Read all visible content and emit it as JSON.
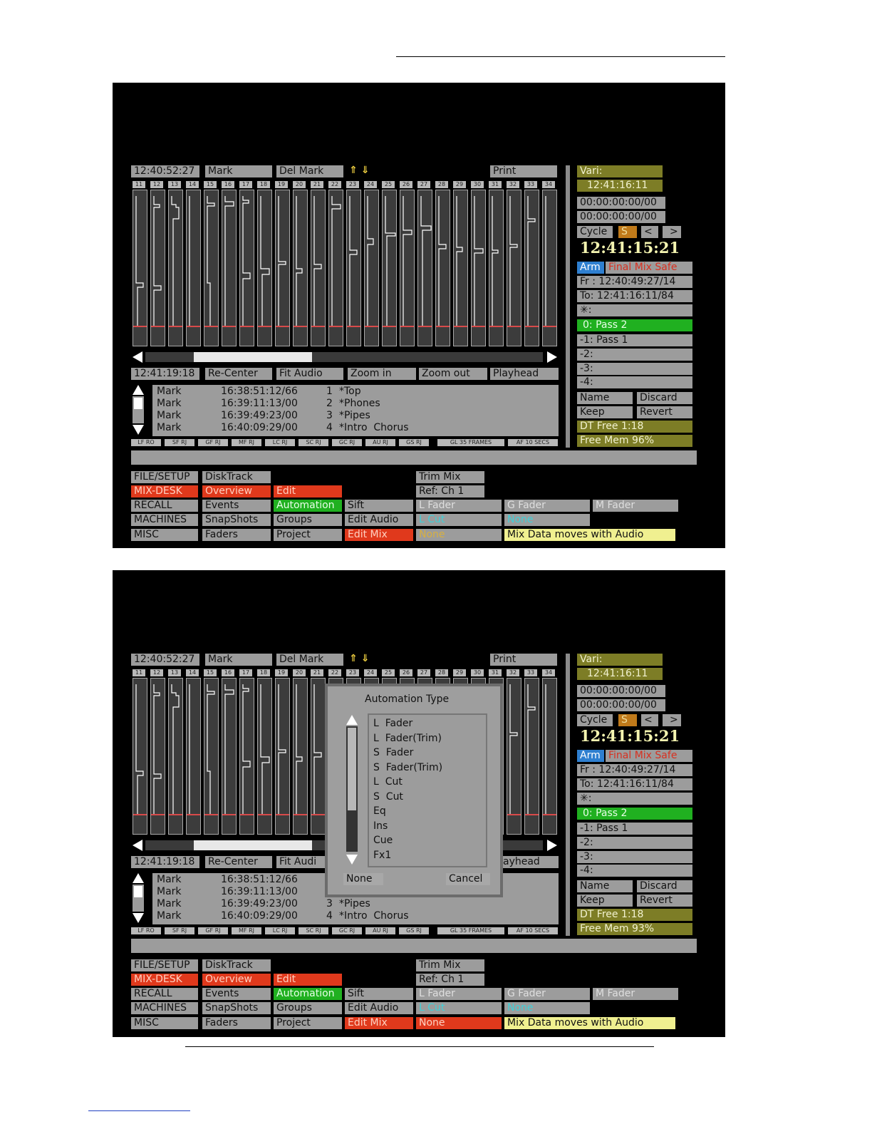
{
  "colors": {
    "background": "#000000",
    "panel": "#9c9c9c",
    "olive": "#7d7d26",
    "green": "#20b020",
    "red": "#e0391c",
    "yellow": "#f0f090",
    "blue": "#2e7fd0",
    "cyan": "#3fd0d8"
  },
  "top_bar": {
    "time": "12:40:52:27",
    "mark": "Mark",
    "del_mark": "Del  Mark",
    "arrows": "⇑ ⇓",
    "print": "Print"
  },
  "track_numbers": [
    "11",
    "12",
    "13",
    "14",
    "15",
    "16",
    "17",
    "18",
    "19",
    "20",
    "21",
    "22",
    "23",
    "24",
    "25",
    "26",
    "27",
    "28",
    "29",
    "30",
    "31",
    "32",
    "33",
    "34"
  ],
  "bottom_bar": {
    "time": "12:41:19:18",
    "recenter": "Re-Center",
    "fit_audio": "Fit  Audio",
    "zoom_in": "Zoom  in",
    "zoom_out": "Zoom  out",
    "playhead": "Playhead"
  },
  "marks": [
    {
      "type": "Mark",
      "time": "16:38:51:12/66",
      "num": "1",
      "name": "*Top"
    },
    {
      "type": "Mark",
      "time": "16:39:11:13/00",
      "num": "2",
      "name": "*Phones"
    },
    {
      "type": "Mark",
      "time": "16:39:49:23/00",
      "num": "3",
      "name": "*Pipes"
    },
    {
      "type": "Mark",
      "time": "16:40:09:29/00",
      "num": "4",
      "name": "*Intro  Chorus"
    }
  ],
  "status_tags": [
    "LF RO",
    "SF RJ",
    "GF RJ",
    "MF RJ",
    "LC RJ",
    "SC RJ",
    "GC RJ",
    "AU RJ",
    "GS RJ",
    "GL 35 FRAMES",
    "AF 10 SECS"
  ],
  "side": {
    "vari": "Vari:",
    "vari_time": "12:41:16:11",
    "tc1": "00:00:00:00/00",
    "tc2": "00:00:00:00/00",
    "cycle": "Cycle",
    "s": "S",
    "prev": "<",
    "next": ">",
    "clock": "12:41:15:21",
    "arm": "Arm",
    "final_mix_safe": "Final Mix Safe",
    "fr": "Fr : 12:40:49:27/14",
    "to": "To: 12:41:16:11/84",
    "star": "✳:",
    "passes": [
      "0: Pass  2",
      "-1: Pass  1",
      "-2:",
      "-3:",
      "-4:"
    ],
    "name": "Name",
    "discard": "Discard",
    "keep": "Keep",
    "revert": "Revert",
    "dt_free": "DT  Free   1:18",
    "free_mem_1": "Free  Mem  96%",
    "free_mem_2": "Free  Mem  93%"
  },
  "menu": {
    "file_setup": "FILE/SETUP",
    "mix_desk": "MIX-DESK",
    "recall": "RECALL",
    "machines": "MACHINES",
    "misc": "MISC",
    "disktrack": "DiskTrack",
    "overview": "Overview",
    "events": "Events",
    "snapshots": "SnapShots",
    "faders": "Faders",
    "edit": "Edit",
    "automation": "Automation",
    "groups": "Groups",
    "project": "Project",
    "trim_mix": "Trim  Mix",
    "ref_ch": "Ref:  Ch   1",
    "sift": "Sift",
    "edit_audio": "Edit  Audio",
    "edit_mix": "Edit  Mix",
    "l_fader": "L  Fader",
    "l_cut": "L  Cut",
    "none": "None",
    "g_fader": "G  Fader",
    "m_fader": "M  Fader",
    "mix_data": "Mix  Data  moves  with  Audio"
  },
  "dialog": {
    "title": "Automation  Type",
    "items": [
      "L  Fader",
      "L  Fader(Trim)",
      "S  Fader",
      "S  Fader(Trim)",
      "L  Cut",
      "S  Cut",
      "Eq",
      "Ins",
      "Cue",
      "Fx1"
    ],
    "none": "None",
    "cancel": "Cancel",
    "partial_fit_audio": "Fit  Audi",
    "partial_playhead": "ayhead"
  }
}
